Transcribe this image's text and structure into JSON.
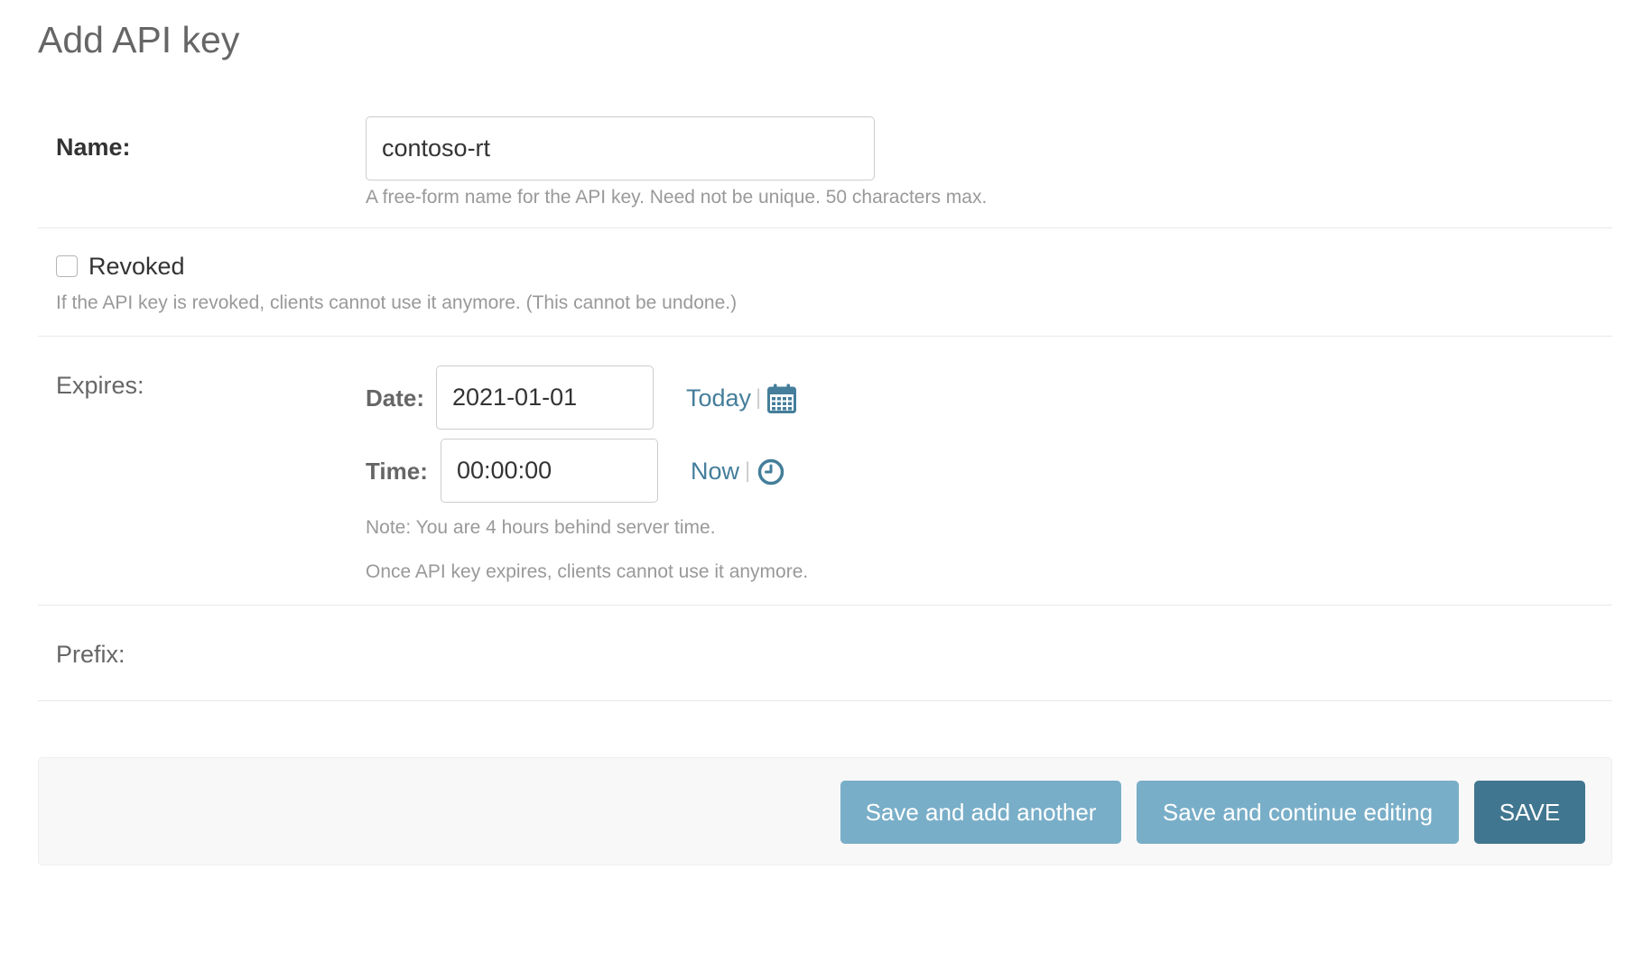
{
  "page": {
    "title": "Add API key"
  },
  "name_field": {
    "label": "Name:",
    "value": "contoso-rt",
    "help": "A free-form name for the API key. Need not be unique. 50 characters max."
  },
  "revoked_field": {
    "label": "Revoked",
    "checked": false,
    "help": "If the API key is revoked, clients cannot use it anymore. (This cannot be undone.)"
  },
  "expires_field": {
    "label": "Expires:",
    "date_label": "Date:",
    "date_value": "2021-01-01",
    "today_link": "Today",
    "separator": "|",
    "time_label": "Time:",
    "time_value": "00:00:00",
    "now_link": "Now",
    "timezone_note": "Note: You are 4 hours behind server time.",
    "help": "Once API key expires, clients cannot use it anymore.",
    "calendar_icon": "calendar-icon",
    "clock_icon": "clock-icon"
  },
  "prefix_field": {
    "label": "Prefix:"
  },
  "actions": {
    "save_add_another": "Save and add another",
    "save_continue": "Save and continue editing",
    "save": "SAVE"
  },
  "colors": {
    "link": "#447e9b",
    "secondary_button": "#79aec8",
    "primary_button": "#417690",
    "help_text": "#999999"
  }
}
